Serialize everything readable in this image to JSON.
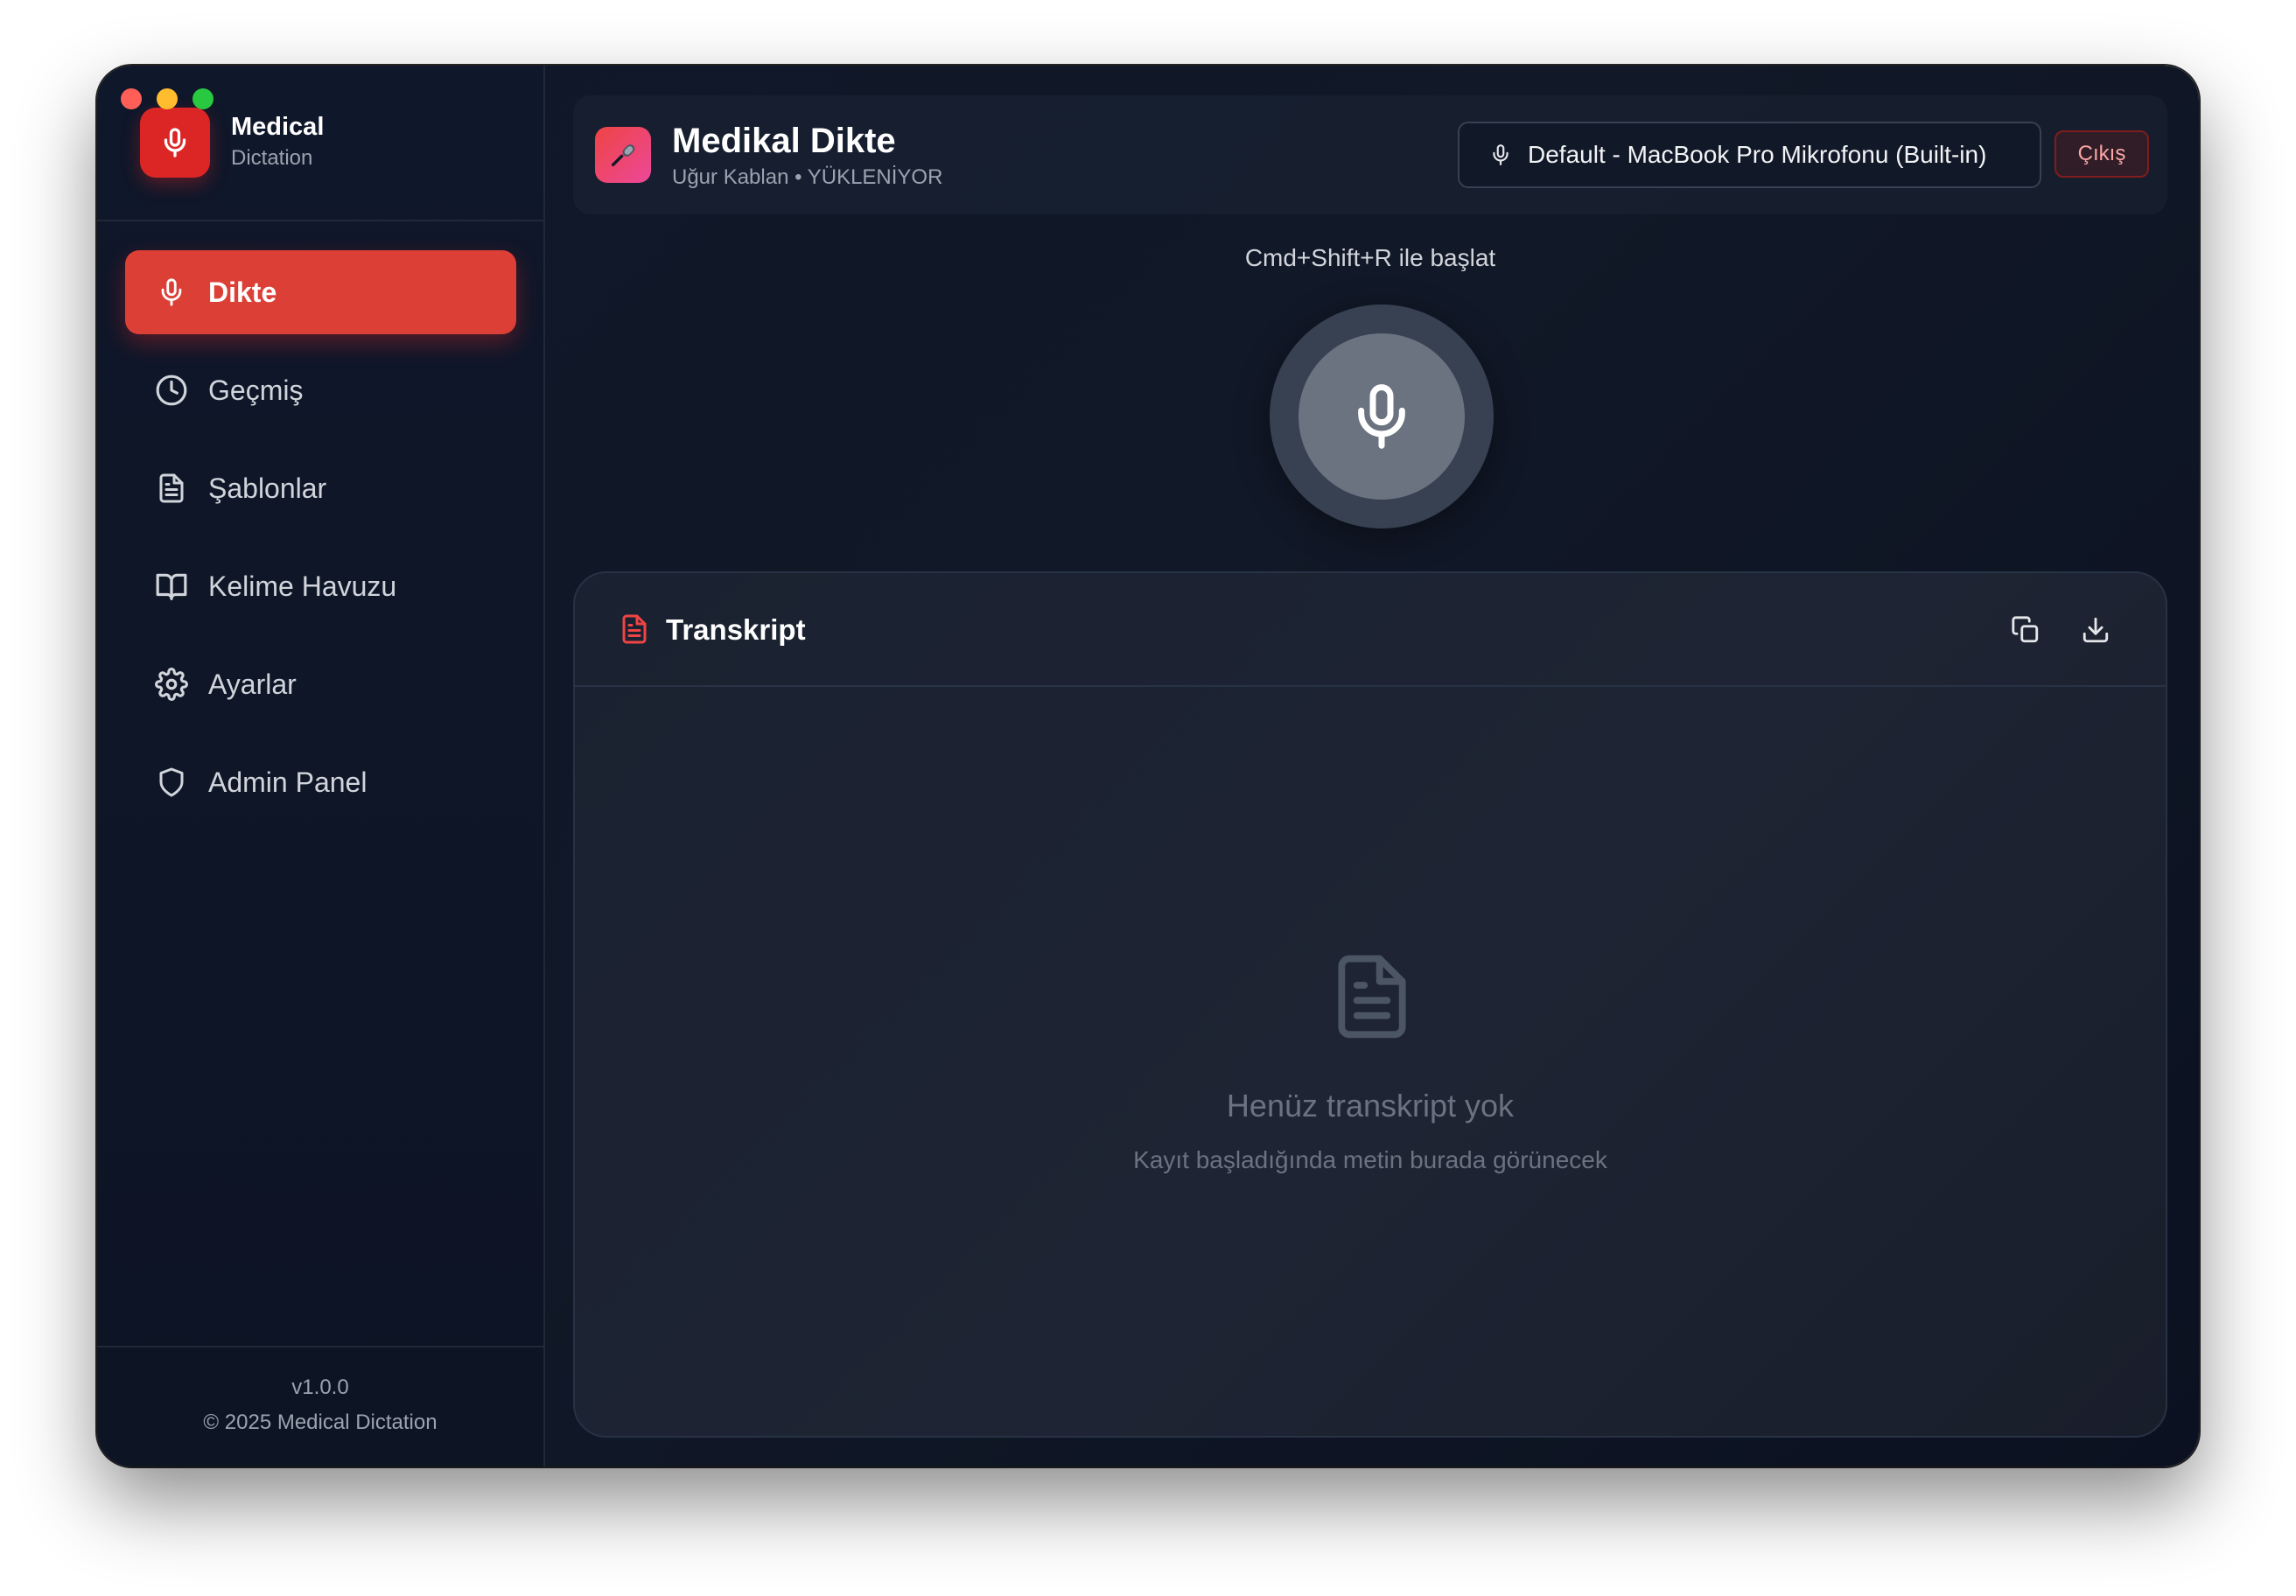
{
  "brand": {
    "name": "Medical",
    "subtitle": "Dictation"
  },
  "nav": {
    "items": [
      {
        "label": "Dikte",
        "icon": "mic-icon",
        "active": true
      },
      {
        "label": "Geçmiş",
        "icon": "clock-icon"
      },
      {
        "label": "Şablonlar",
        "icon": "file-text-icon"
      },
      {
        "label": "Kelime Havuzu",
        "icon": "book-open-icon"
      },
      {
        "label": "Ayarlar",
        "icon": "gear-icon"
      },
      {
        "label": "Admin Panel",
        "icon": "shield-icon"
      }
    ]
  },
  "footer": {
    "version": "v1.0.0",
    "copyright": "© 2025 Medical Dictation"
  },
  "header": {
    "title": "Medikal Dikte",
    "user": "Uğur Kablan • YÜKLENİYOR",
    "microphone": "Default - MacBook Pro Mikrofonu (Built-in)",
    "logout_label": "Çıkış"
  },
  "recorder": {
    "hotkey_hint": "Cmd+Shift+R ile başlat"
  },
  "transcript": {
    "title": "Transkript",
    "empty_title": "Henüz transkript yok",
    "empty_subtitle": "Kayıt başladığında metin burada görünecek"
  },
  "colors": {
    "accent": "#dc3f35",
    "background": "#0f172a",
    "panel": "#1e2433",
    "muted_text": "#9ca3af"
  }
}
